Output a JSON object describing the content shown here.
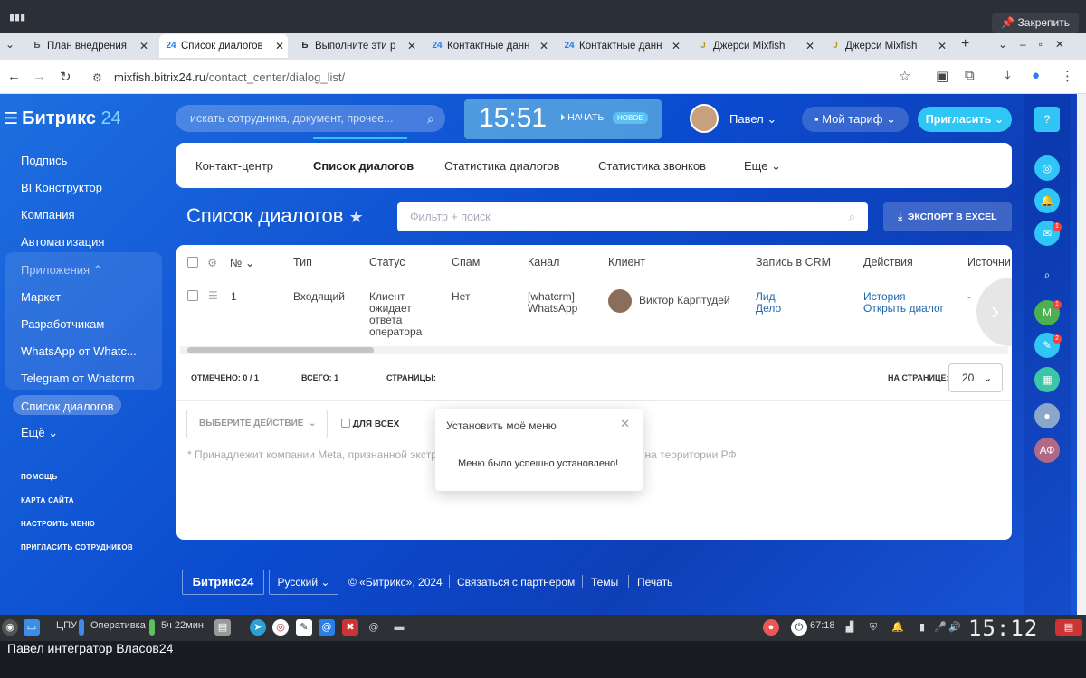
{
  "os": {
    "pin_label": "Закрепить"
  },
  "browser": {
    "tabs": [
      {
        "label": "План внедрения",
        "icon": "Б"
      },
      {
        "label": "Список диалогов",
        "icon": "24"
      },
      {
        "label": "Выполните эти р",
        "icon": "Б"
      },
      {
        "label": "Контактные данн",
        "icon": "24"
      },
      {
        "label": "Контактные данн",
        "icon": "24"
      },
      {
        "label": "Джерси Mixfish",
        "icon": "J"
      },
      {
        "label": "Джерси Mixfish",
        "icon": "J"
      }
    ],
    "url_host": "mixfish.bitrix24.ru",
    "url_path": "/contact_center/dialog_list/"
  },
  "header": {
    "logo_text": "Битрикс",
    "logo_num": "24",
    "search_placeholder": "искать сотрудника, документ, прочее...",
    "clock": "15:51",
    "start_label": "НАЧАТЬ",
    "new_badge": "НОВОЕ",
    "user_name": "Павел",
    "tariff_label": "Мой тариф",
    "invite_label": "Пригласить"
  },
  "left_menu": {
    "items": [
      "Подпись",
      "BI Конструктор",
      "Компания",
      "Автоматизация"
    ],
    "apps_group": "Приложения",
    "apps": [
      "Маркет",
      "Разработчикам",
      "WhatsApp от Whatc...",
      "Telegram от Whatcrm"
    ],
    "active": "Список диалогов",
    "more": "Ещё",
    "small": [
      "ПОМОЩЬ",
      "КАРТА САЙТА",
      "НАСТРОИТЬ МЕНЮ",
      "ПРИГЛАСИТЬ СОТРУДНИКОВ"
    ]
  },
  "nav_tabs": [
    "Контакт-центр",
    "Список диалогов",
    "Статистика диалогов",
    "Статистика звонков",
    "Еще"
  ],
  "page_title": "Список диалогов",
  "filter_placeholder": "Фильтр + поиск",
  "export_label": "ЭКСПОРТ В EXCEL",
  "grid": {
    "columns": [
      "№",
      "Тип",
      "Статус",
      "Спам",
      "Канал",
      "Клиент",
      "Запись в CRM",
      "Действия",
      "Источни"
    ],
    "row": {
      "num": "1",
      "type": "Входящий",
      "status": [
        "Клиент",
        "ожидает",
        "ответа",
        "оператора"
      ],
      "spam": "Нет",
      "channel": [
        "[whatcrm]",
        "WhatsApp"
      ],
      "client": "Виктор Карптудей",
      "crm": [
        "Лид",
        "Дело"
      ],
      "actions": [
        "История",
        "Открыть диалог"
      ],
      "source": "-"
    },
    "marked_label": "ОТМЕЧЕНО:",
    "marked_value": "0 / 1",
    "total_label": "ВСЕГО:",
    "total_value": "1",
    "pages_label": "СТРАНИЦЫ:",
    "per_page_label": "НА СТРАНИЦЕ:",
    "per_page_value": "20",
    "action_select": "ВЫБЕРИТЕ ДЕЙСТВИЕ",
    "for_all": "ДЛЯ ВСЕХ",
    "notice": "* Принадлежит компании Meta, признанной экстремистской организацией и запрещённой на территории РФ"
  },
  "popup": {
    "title": "Установить моё меню",
    "message": "Меню было успешно установлено!"
  },
  "footer": {
    "logo": "Битрикс24",
    "lang": "Русский",
    "copyright": "© «Битрикс», 2024",
    "partner": "Связаться с партнером",
    "themes": "Темы",
    "print": "Печать"
  },
  "taskbar": {
    "cpu_label": "ЦПУ",
    "mem_label": "Оперативка",
    "uptime": "5ч 22мин",
    "battery": "67:18",
    "clock": "15:12"
  },
  "bottom_name": "Павел интегратор Власов24"
}
